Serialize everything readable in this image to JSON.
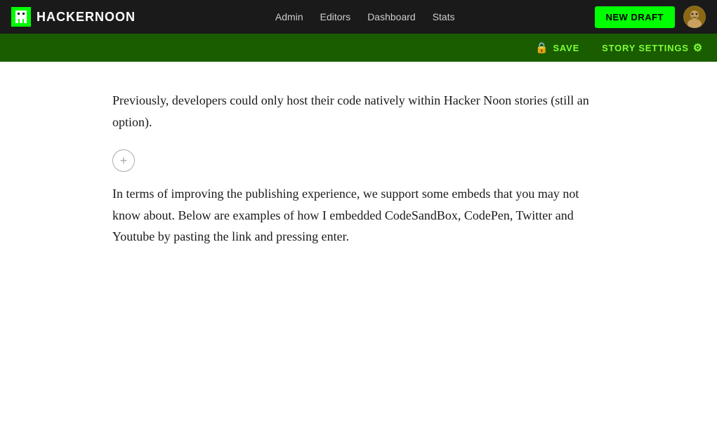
{
  "navbar": {
    "logo_text": "HACKERNOON",
    "links": [
      {
        "label": "Admin",
        "id": "admin"
      },
      {
        "label": "Editors",
        "id": "editors"
      },
      {
        "label": "Dashboard",
        "id": "dashboard"
      },
      {
        "label": "Stats",
        "id": "stats"
      }
    ],
    "new_draft_label": "NEW DRAFT",
    "accent_color": "#00ff00"
  },
  "toolbar": {
    "save_label": "SAVE",
    "story_settings_label": "STORY SETTINGS",
    "save_icon": "🔒",
    "settings_icon": "⚙"
  },
  "editor": {
    "paragraph1": "Previously, developers could only host their code natively within Hacker Noon stories (still an option).",
    "paragraph2": "In terms of improving the publishing experience, we support some embeds that you may not know about. Below are examples of how I embedded CodeSandBox, CodePen, Twitter and Youtube by pasting the link and pressing enter.",
    "add_block_icon": "+"
  }
}
